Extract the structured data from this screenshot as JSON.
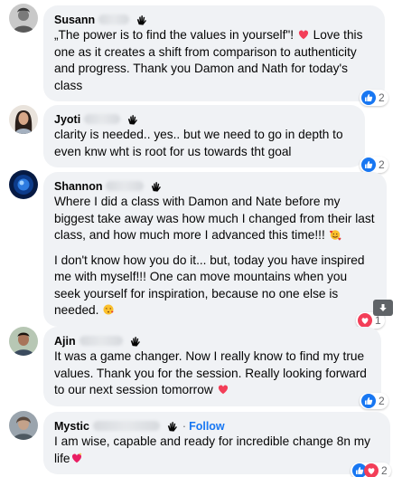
{
  "comments": [
    {
      "author": "Susann",
      "paragraphs": [
        "„The power is to find the values in yourself\"! "
      ],
      "paragraph_tail": [
        " Love this one as it creates a shift from comparison to authenticity and progress. Thank you Damon and Nath for today's class"
      ],
      "reaction_count": "2"
    },
    {
      "author": "Jyoti",
      "paragraphs": [
        "clarity is needed.. yes.. but we need to go in depth to even knw wht is root for us towards tht goal"
      ],
      "reaction_count": "2"
    },
    {
      "author": "Shannon",
      "paragraphs": [
        "Where I did a class with Damon and Nate before my biggest take away was how much I changed from their last class, and how much more I advanced this time!!! ",
        "I don't know how you do it... but, today you have inspired me with myself!!! One can move mountains when you seek yourself for inspiration, because no one else is needed. "
      ],
      "reaction_count": "1"
    },
    {
      "author": "Ajin",
      "paragraphs": [
        "It was a game changer. Now I really know to find my true values. Thank you for the session. Really looking forward to our next session tomorrow "
      ],
      "reaction_count": "2"
    },
    {
      "author": "Mystic",
      "follow_label": "Follow",
      "paragraphs": [
        "I am wise, capable and ready for incredible change 8n my life"
      ],
      "reaction_count": "2"
    }
  ],
  "icons": {
    "wave": "waving-hand-icon",
    "like": "thumbs-up-icon",
    "love": "heart-icon",
    "scroll": "arrow-down-icon"
  },
  "colors": {
    "bubble": "#f0f2f5",
    "link": "#1877f2",
    "love": "#f33e58",
    "like": "#1877f2"
  }
}
